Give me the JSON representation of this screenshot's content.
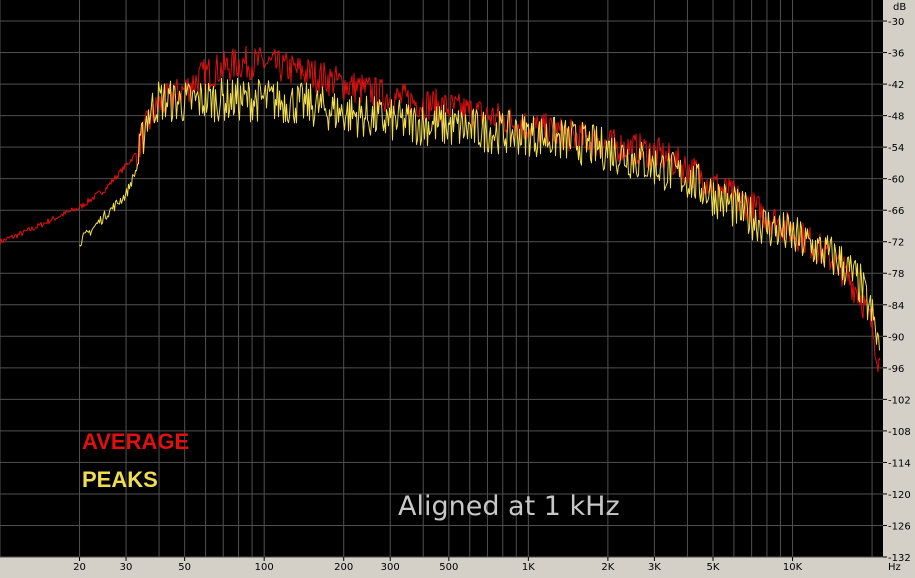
{
  "chart_data": {
    "type": "line",
    "title": "",
    "xlabel": "",
    "ylabel": "",
    "x_unit": "Hz",
    "y_unit": "dB",
    "x_scale": "log",
    "x_range": [
      10,
      22000
    ],
    "y_range": [
      -132,
      -26
    ],
    "grid": true,
    "background_color": "#000000",
    "grid_color": "#505050",
    "x_ticks": [
      {
        "value": 20,
        "label": "20"
      },
      {
        "value": 30,
        "label": "30"
      },
      {
        "value": 50,
        "label": "50"
      },
      {
        "value": 100,
        "label": "100"
      },
      {
        "value": 200,
        "label": "200"
      },
      {
        "value": 300,
        "label": "300"
      },
      {
        "value": 500,
        "label": "500"
      },
      {
        "value": 1000,
        "label": "1K"
      },
      {
        "value": 2000,
        "label": "2K"
      },
      {
        "value": 3000,
        "label": "3K"
      },
      {
        "value": 5000,
        "label": "5K"
      },
      {
        "value": 10000,
        "label": "10K"
      }
    ],
    "y_ticks": [
      {
        "value": -30,
        "label": "-30"
      },
      {
        "value": -36,
        "label": "-36"
      },
      {
        "value": -42,
        "label": "-42"
      },
      {
        "value": -48,
        "label": "-48"
      },
      {
        "value": -54,
        "label": "-54"
      },
      {
        "value": -60,
        "label": "-60"
      },
      {
        "value": -66,
        "label": "-66"
      },
      {
        "value": -72,
        "label": "-72"
      },
      {
        "value": -78,
        "label": "-78"
      },
      {
        "value": -84,
        "label": "-84"
      },
      {
        "value": -90,
        "label": "-90"
      },
      {
        "value": -96,
        "label": "-96"
      },
      {
        "value": -102,
        "label": "-102"
      },
      {
        "value": -108,
        "label": "-108"
      },
      {
        "value": -114,
        "label": "-114"
      },
      {
        "value": -120,
        "label": "-120"
      },
      {
        "value": -126,
        "label": "-126"
      },
      {
        "value": -132,
        "label": "-132"
      }
    ],
    "legend_position": "bottom-left",
    "annotation": "Aligned at 1 kHz",
    "series": [
      {
        "name": "AVERAGE",
        "color": "#e01010",
        "x": [
          10,
          12,
          14,
          17,
          20,
          25,
          30,
          33,
          36,
          40,
          50,
          60,
          80,
          100,
          120,
          150,
          200,
          300,
          500,
          700,
          1000,
          1500,
          2000,
          3000,
          4000,
          5000,
          6000,
          8000,
          10000,
          12000,
          15000,
          18000,
          20000,
          21500
        ],
        "y": [
          -72,
          -70.5,
          -69,
          -67,
          -65.5,
          -62,
          -57.5,
          -55,
          -50,
          -46,
          -43,
          -40,
          -38,
          -38,
          -39,
          -40,
          -42,
          -44.5,
          -46.5,
          -48,
          -50,
          -52,
          -53.5,
          -55,
          -58,
          -61,
          -63.5,
          -67,
          -70,
          -72.5,
          -76.5,
          -82,
          -88,
          -96
        ]
      },
      {
        "name": "PEAKS",
        "color": "#f0dc50",
        "x": [
          20,
          21,
          25,
          30,
          33,
          36,
          40,
          50,
          60,
          80,
          100,
          150,
          200,
          300,
          500,
          700,
          1000,
          1500,
          2000,
          3000,
          4000,
          5000,
          6000,
          8000,
          10000,
          12000,
          15000,
          18000,
          20000,
          21500
        ],
        "y": [
          -72,
          -71,
          -67,
          -63,
          -58,
          -48,
          -45,
          -45.5,
          -45,
          -45,
          -45,
          -46,
          -47.5,
          -49,
          -50,
          -51,
          -51.5,
          -53,
          -54.5,
          -57.5,
          -60,
          -63,
          -65.5,
          -69,
          -71,
          -73,
          -75.5,
          -80,
          -86,
          -93
        ]
      }
    ]
  }
}
